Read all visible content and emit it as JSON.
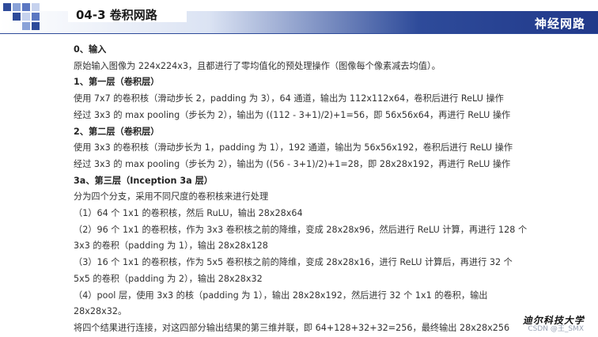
{
  "header": {
    "title": "04-3 卷积网路",
    "brand": "神经网路",
    "accent": "#2e4b9a",
    "square_colors": [
      "#2e4b9a",
      "#8aa2d8",
      "#5b77c2",
      "#c6d2ee"
    ]
  },
  "content": {
    "lines": [
      {
        "text": "0、输入",
        "heading": true
      },
      {
        "text": "原始输入图像为 224x224x3，且都进行了零均值化的预处理操作（图像每个像素减去均值）。",
        "heading": false
      },
      {
        "text": "1、第一层（卷积层）",
        "heading": true
      },
      {
        "text": "使用 7x7 的卷积核（滑动步长 2，padding 为 3），64 通道，输出为 112x112x64，卷积后进行 ReLU 操作",
        "heading": false
      },
      {
        "text": "经过 3x3 的 max pooling（步长为 2），输出为 ((112 - 3+1)/2)+1=56，即 56x56x64，再进行 ReLU 操作",
        "heading": false
      },
      {
        "text": "2、第二层（卷积层）",
        "heading": true
      },
      {
        "text": "使用 3x3 的卷积核（滑动步长为 1，padding 为 1），192 通道，输出为 56x56x192，卷积后进行 ReLU 操作",
        "heading": false
      },
      {
        "text": "经过 3x3 的 max pooling（步长为 2），输出为 ((56 - 3+1)/2)+1=28，即 28x28x192，再进行 ReLU 操作",
        "heading": false
      },
      {
        "text": "3a、第三层（Inception 3a 层）",
        "heading": true
      },
      {
        "text": "分为四个分支，采用不同尺度的卷积核来进行处理",
        "heading": false
      },
      {
        "text": "（1）64 个 1x1 的卷积核，然后 RuLU，输出 28x28x64",
        "heading": false
      },
      {
        "text": "（2）96 个 1x1 的卷积核，作为 3x3 卷积核之前的降维，变成 28x28x96，然后进行 ReLU 计算，再进行 128 个",
        "heading": false
      },
      {
        "text": "3x3 的卷积（padding 为 1），输出 28x28x128",
        "heading": false
      },
      {
        "text": "（3）16 个 1x1 的卷积核，作为 5x5 卷积核之前的降维，变成 28x28x16，进行 ReLU 计算后，再进行 32 个",
        "heading": false
      },
      {
        "text": "5x5 的卷积（padding 为 2），输出 28x28x32",
        "heading": false
      },
      {
        "text": "（4）pool 层，使用 3x3 的核（padding 为 1），输出 28x28x192，然后进行 32 个 1x1 的卷积，输出",
        "heading": false
      },
      {
        "text": "28x28x32。",
        "heading": false
      },
      {
        "text": "将四个结果进行连接，对这四部分输出结果的第三维并联，即 64+128+32+32=256，最终输出 28x28x256",
        "heading": false
      }
    ]
  },
  "footer": {
    "logo_text": "迪尔科技大学",
    "watermark": "CSDN @王_SMX"
  }
}
